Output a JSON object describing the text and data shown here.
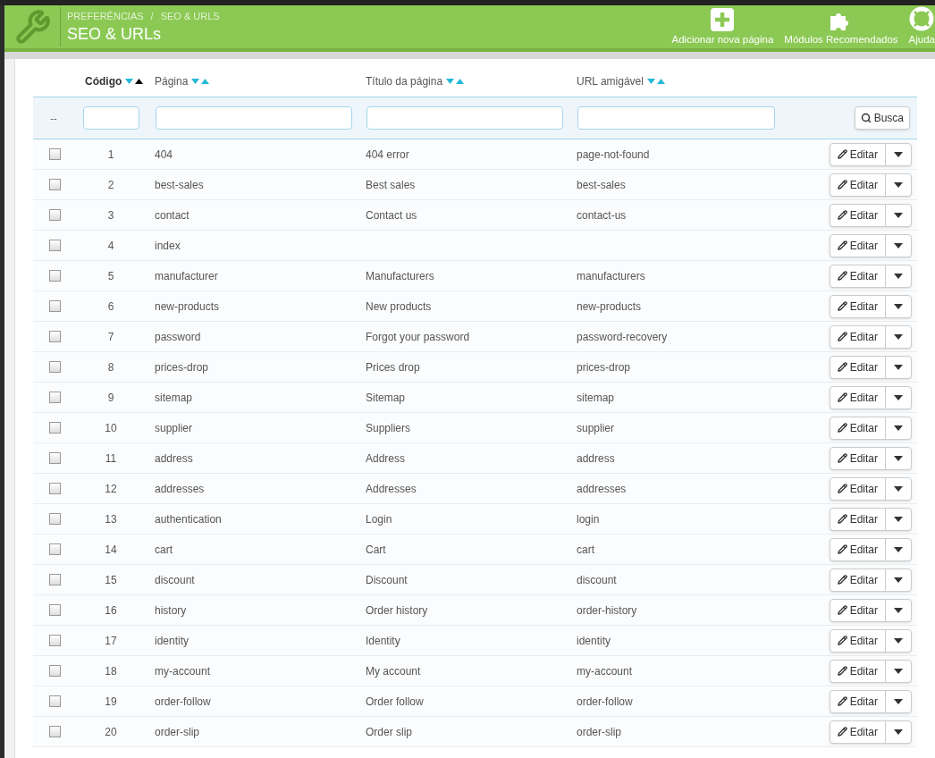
{
  "header": {
    "breadcrumb": [
      "PREFERÊNCIAS",
      "SEO & URLS"
    ],
    "breadcrumb_separator": "/",
    "title": "SEO & URLs",
    "actions": [
      {
        "kind": "add",
        "label": "Adicionar nova página"
      },
      {
        "kind": "modules",
        "label": "Módulos Recomendados"
      },
      {
        "kind": "help",
        "label": "Ajuda"
      }
    ]
  },
  "table": {
    "columns": [
      {
        "label": "Código",
        "sorted": true
      },
      {
        "label": "Página",
        "sorted": false
      },
      {
        "label": "Título da página",
        "sorted": false
      },
      {
        "label": "URL amigável",
        "sorted": false
      }
    ],
    "filter": {
      "bulk_label": "--",
      "search_button": "Busca"
    },
    "rows": [
      {
        "checked": false,
        "id": "1",
        "page": "404",
        "title": "404 error",
        "url": "page-not-found",
        "action": "Editar"
      },
      {
        "checked": false,
        "id": "2",
        "page": "best-sales",
        "title": "Best sales",
        "url": "best-sales",
        "action": "Editar"
      },
      {
        "checked": false,
        "id": "3",
        "page": "contact",
        "title": "Contact us",
        "url": "contact-us",
        "action": "Editar"
      },
      {
        "checked": false,
        "id": "4",
        "page": "index",
        "action": "Editar"
      },
      {
        "checked": false,
        "id": "5",
        "page": "manufacturer",
        "title": "Manufacturers",
        "url": "manufacturers",
        "action": "Editar"
      },
      {
        "checked": false,
        "id": "6",
        "page": "new-products",
        "title": "New products",
        "url": "new-products",
        "action": "Editar"
      },
      {
        "checked": false,
        "id": "7",
        "page": "password",
        "title": "Forgot your password",
        "url": "password-recovery",
        "action": "Editar"
      },
      {
        "checked": false,
        "id": "8",
        "page": "prices-drop",
        "title": "Prices drop",
        "url": "prices-drop",
        "action": "Editar"
      },
      {
        "checked": false,
        "id": "9",
        "page": "sitemap",
        "title": "Sitemap",
        "url": "sitemap",
        "action": "Editar"
      },
      {
        "checked": false,
        "id": "10",
        "page": "supplier",
        "title": "Suppliers",
        "url": "supplier",
        "action": "Editar"
      },
      {
        "checked": false,
        "id": "11",
        "page": "address",
        "title": "Address",
        "url": "address",
        "action": "Editar"
      },
      {
        "checked": false,
        "id": "12",
        "page": "addresses",
        "title": "Addresses",
        "url": "addresses",
        "action": "Editar"
      },
      {
        "checked": false,
        "id": "13",
        "page": "authentication",
        "title": "Login",
        "url": "login",
        "action": "Editar"
      },
      {
        "checked": false,
        "id": "14",
        "page": "cart",
        "title": "Cart",
        "url": "cart",
        "action": "Editar"
      },
      {
        "checked": false,
        "id": "15",
        "page": "discount",
        "title": "Discount",
        "url": "discount",
        "action": "Editar"
      },
      {
        "checked": false,
        "id": "16",
        "page": "history",
        "title": "Order history",
        "url": "order-history",
        "action": "Editar"
      },
      {
        "checked": false,
        "id": "17",
        "page": "identity",
        "title": "Identity",
        "url": "identity",
        "action": "Editar"
      },
      {
        "checked": false,
        "id": "18",
        "page": "my-account",
        "title": "My account",
        "url": "my-account",
        "action": "Editar"
      },
      {
        "checked": false,
        "id": "19",
        "page": "order-follow",
        "title": "Order follow",
        "url": "order-follow",
        "action": "Editar"
      },
      {
        "checked": false,
        "id": "20",
        "page": "order-slip",
        "title": "Order slip",
        "url": "order-slip",
        "action": "Editar"
      }
    ]
  }
}
